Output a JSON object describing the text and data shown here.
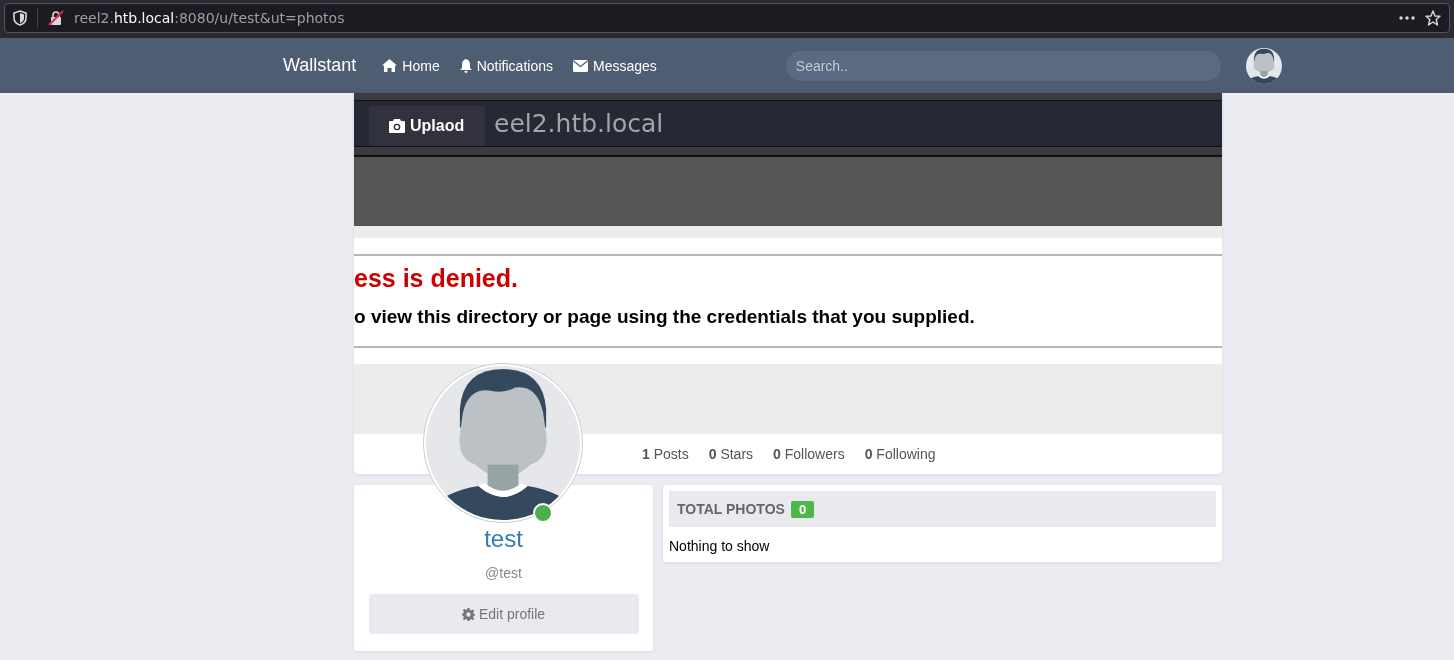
{
  "browser": {
    "url_prefix": "reel2.",
    "url_host": "htb.local",
    "url_rest": ":8080/u/test&ut=photos"
  },
  "navbar": {
    "brand": "Wallstant",
    "links": [
      {
        "label": "Home",
        "kind": "home"
      },
      {
        "label": "Notifications",
        "kind": "bell"
      },
      {
        "label": "Messages",
        "kind": "envelope"
      }
    ],
    "search": {
      "placeholder": "Search.."
    }
  },
  "cover": {
    "screenshot": {
      "hostname": "eel2.htb.local",
      "heading": "ess is denied.",
      "message": "o view this directory or page using the credentials that you supplied."
    },
    "upload_button": "Uplaod"
  },
  "stats": [
    {
      "count": "1",
      "label": "Posts"
    },
    {
      "count": "0",
      "label": "Stars"
    },
    {
      "count": "0",
      "label": "Followers"
    },
    {
      "count": "0",
      "label": "Following"
    }
  ],
  "profile": {
    "name": "test",
    "handle": "@test",
    "online": true,
    "edit_button": "Edit profile"
  },
  "photos": {
    "title": "TOTAL PHOTOS",
    "count": "0",
    "empty_text": "Nothing to show"
  }
}
